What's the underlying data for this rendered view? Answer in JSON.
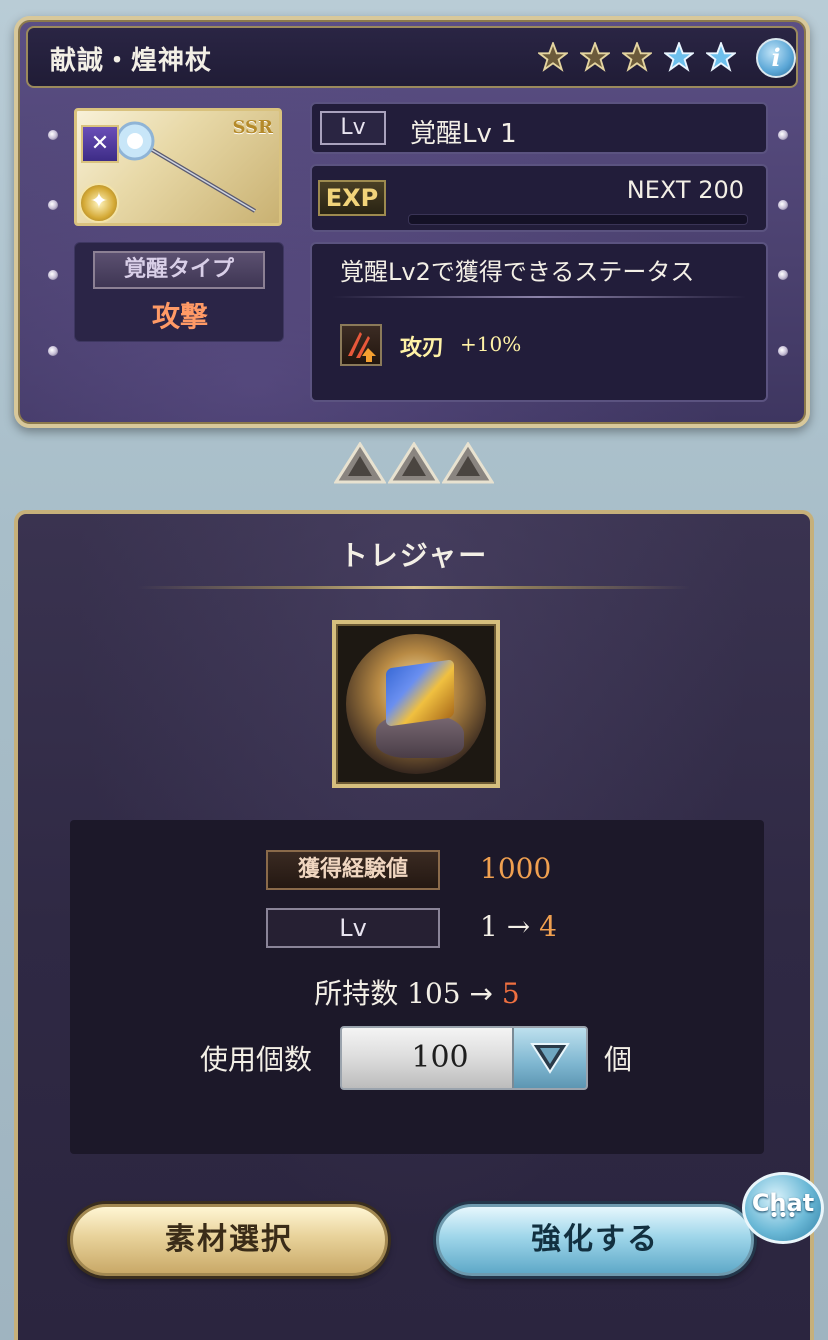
{
  "weapon": {
    "name": "献誠・煌神杖",
    "stars_filled": 3,
    "stars_total": 5,
    "rarity": "SSR",
    "info_icon": "i"
  },
  "awakening": {
    "type_label": "覚醒タイプ",
    "type_value": "攻撃",
    "lv_tag": "Lv",
    "level_text": "覚醒Lv 1",
    "exp_tag": "EXP",
    "next_text": "NEXT 200",
    "exp_progress": 0.0,
    "next_status_title": "覚醒Lv2で獲得できるステータス",
    "skill_name": "攻刃",
    "skill_value": "+10%"
  },
  "treasure": {
    "section_title": "トレジャー",
    "exp_gain_label": "獲得経験値",
    "exp_gain_value": "1000",
    "lv_label": "Lv",
    "lv_from": "1",
    "lv_arrow": "→",
    "lv_to": "4",
    "owned_label": "所持数",
    "owned_from": "105",
    "owned_arrow": "→",
    "owned_to": "5",
    "use_count_label": "使用個数",
    "quantity": "100",
    "unit_label": "個"
  },
  "buttons": {
    "material_select": "素材選択",
    "enhance": "強化する",
    "chat": "Chat",
    "chat_dots": "•••"
  },
  "colors": {
    "accent_orange": "#f0a050",
    "highlight_red": "#f07040",
    "attack_type": "#ff9a66",
    "gold_border": "#d8c89a"
  }
}
